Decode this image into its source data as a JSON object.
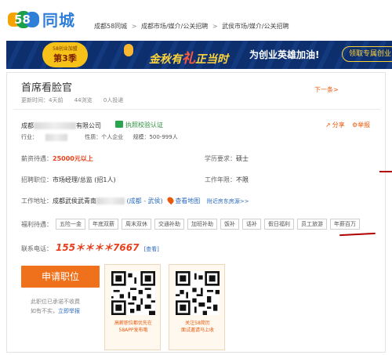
{
  "logo": {
    "text": "同城",
    "mark": "58"
  },
  "breadcrumb": [
    "成都58同城",
    "成都市场/媒介/公关招聘",
    "武侯市场/媒介/公关招聘"
  ],
  "banner": {
    "badge_top": "58创业加盟",
    "badge_main": "第3季",
    "slogan_a": "金秋有",
    "slogan_zi": "礼",
    "slogan_b": "正当时",
    "slogan2": "为创业英雄加油!",
    "cta": "领取专属创业"
  },
  "job": {
    "title": "首席看脸官",
    "updated": "更新时间：4天前",
    "views": "44浏览",
    "applicants": "0人投递",
    "next": "下一条>"
  },
  "company": {
    "name_prefix": "成都",
    "name_suffix": "有限公司",
    "verified": "执照校验认证",
    "share": "分享",
    "report": "举报",
    "industry": "行业：",
    "nature": "性质：个人企业",
    "scale": "规模：500-999人"
  },
  "details": {
    "salary_label": "薪资待遇：",
    "salary_value": "25000元以上",
    "education_label": "学历要求：",
    "education_value": "硕士",
    "position_label": "招聘职位：",
    "position_value": "市场经理/总监 (招1人)",
    "experience_label": "工作年限：",
    "experience_value": "不限",
    "address_label": "工作地址：",
    "address_value": "成都武侯武青南",
    "address_area": "(成都 - 武侯)",
    "map_link": "查看地图",
    "nearby": "附近房东房源>>"
  },
  "welfare": {
    "label": "福利待遇：",
    "tags": [
      "五险一金",
      "年底双薪",
      "周末双休",
      "交通补助",
      "加班补助",
      "饭补",
      "话补",
      "假日福利",
      "员工旅游",
      "年薪百万"
    ]
  },
  "contact": {
    "label": "联系电话：",
    "number": "155＊＊＊＊7667",
    "view": "[查看]"
  },
  "apply": {
    "button": "申请职位",
    "notice_line1": "此职位已承诺不收费",
    "notice_line2_prefix": "如有不实，",
    "notice_line2_link": "立即举报"
  },
  "qr": [
    {
      "caption_line1": "高薪职位都优先在",
      "caption_line2": "58APP发布哦"
    },
    {
      "caption_line1": "关注58简历",
      "caption_line2": "面试邀请马上收"
    }
  ],
  "colors": {
    "accent": "#f0711c",
    "price": "#e8401c",
    "link": "#2f6dbf",
    "brand": "#2f7ed8"
  }
}
